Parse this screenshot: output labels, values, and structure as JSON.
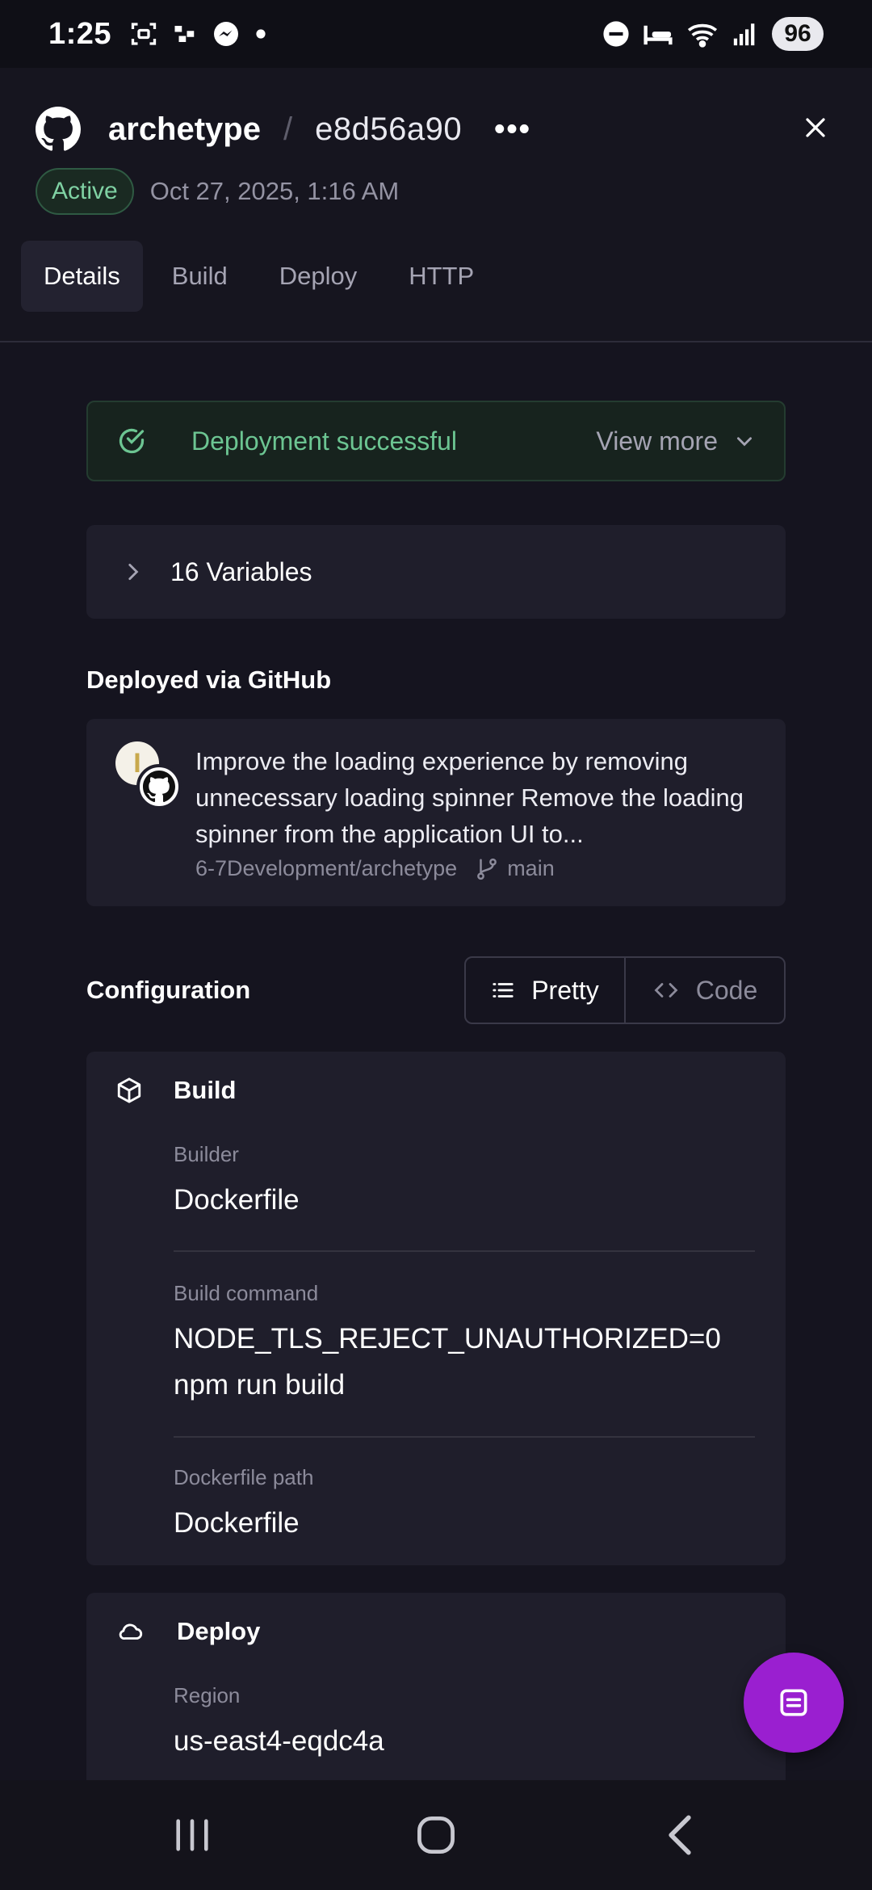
{
  "status_bar": {
    "time": "1:25",
    "battery": "96",
    "icons": [
      "screenshot-icon",
      "activity-icon",
      "messenger-icon",
      "dot-icon",
      "dnd-icon",
      "sleep-icon",
      "wifi-icon",
      "signal-icon"
    ]
  },
  "header": {
    "project": "archetype",
    "separator": "/",
    "commit_id": "e8d56a90",
    "more": "•••",
    "status": "Active",
    "date": "Oct 27, 2025, 1:16 AM",
    "tabs": [
      {
        "label": "Details",
        "active": true
      },
      {
        "label": "Build",
        "active": false
      },
      {
        "label": "Deploy",
        "active": false
      },
      {
        "label": "HTTP",
        "active": false
      }
    ]
  },
  "banner": {
    "text": "Deployment successful",
    "action": "View more"
  },
  "variables": {
    "label": "16 Variables"
  },
  "deployed_via": {
    "title": "Deployed via GitHub",
    "avatar_letter": "I",
    "message": "Improve the loading experience by removing unnecessary loading spinner Remove the loading spinner from the application UI to...",
    "repo": "6-7Development/archetype",
    "branch": "main"
  },
  "configuration": {
    "title": "Configuration",
    "toggle": {
      "pretty": "Pretty",
      "code": "Code",
      "selected": "Pretty"
    },
    "build": {
      "title": "Build",
      "builder_label": "Builder",
      "builder_value": "Dockerfile",
      "command_label": "Build command",
      "command_value": "NODE_TLS_REJECT_UNAUTHORIZED=0 npm run build",
      "path_label": "Dockerfile path",
      "path_value": "Dockerfile"
    },
    "deploy": {
      "title": "Deploy",
      "region_label": "Region",
      "region_value": "us-east4-eqdc4a"
    }
  },
  "colors": {
    "background": "#15141f",
    "card": "#1f1e2b",
    "success": "#6cc592",
    "fab": "#9a1fd0"
  }
}
